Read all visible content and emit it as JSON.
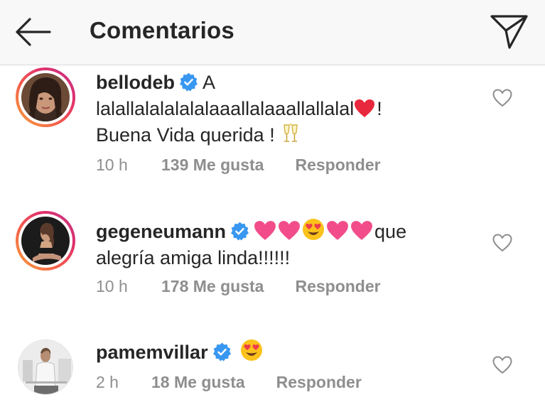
{
  "header": {
    "title": "Comentarios",
    "back_icon": "arrow-left-icon",
    "share_icon": "paper-plane-icon"
  },
  "comments": [
    {
      "username": "bellodeb",
      "verified": true,
      "text_line1": "A",
      "text_line2": "lalallalalalalalaaallalaaallallalal",
      "text_line2_end": "!",
      "text_line3": "Buena Vida querida !",
      "time": "10 h",
      "likes": "139 Me gusta",
      "reply": "Responder",
      "story_ring": true
    },
    {
      "username": "gegeneumann",
      "verified": true,
      "text_after_emojis": "que",
      "text_line2": "alegría amiga linda!!!!!!",
      "time": "10 h",
      "likes": "178 Me gusta",
      "reply": "Responder",
      "story_ring": true
    },
    {
      "username": "pamemvillar",
      "verified": true,
      "time": "2 h",
      "likes": "18 Me gusta",
      "reply": "Responder",
      "story_ring": false
    }
  ],
  "colors": {
    "verified_blue": "#3897f0",
    "heart_red": "#e8283c",
    "heart_pink": "#f24d8a",
    "meta_gray": "#8e8e8e"
  }
}
